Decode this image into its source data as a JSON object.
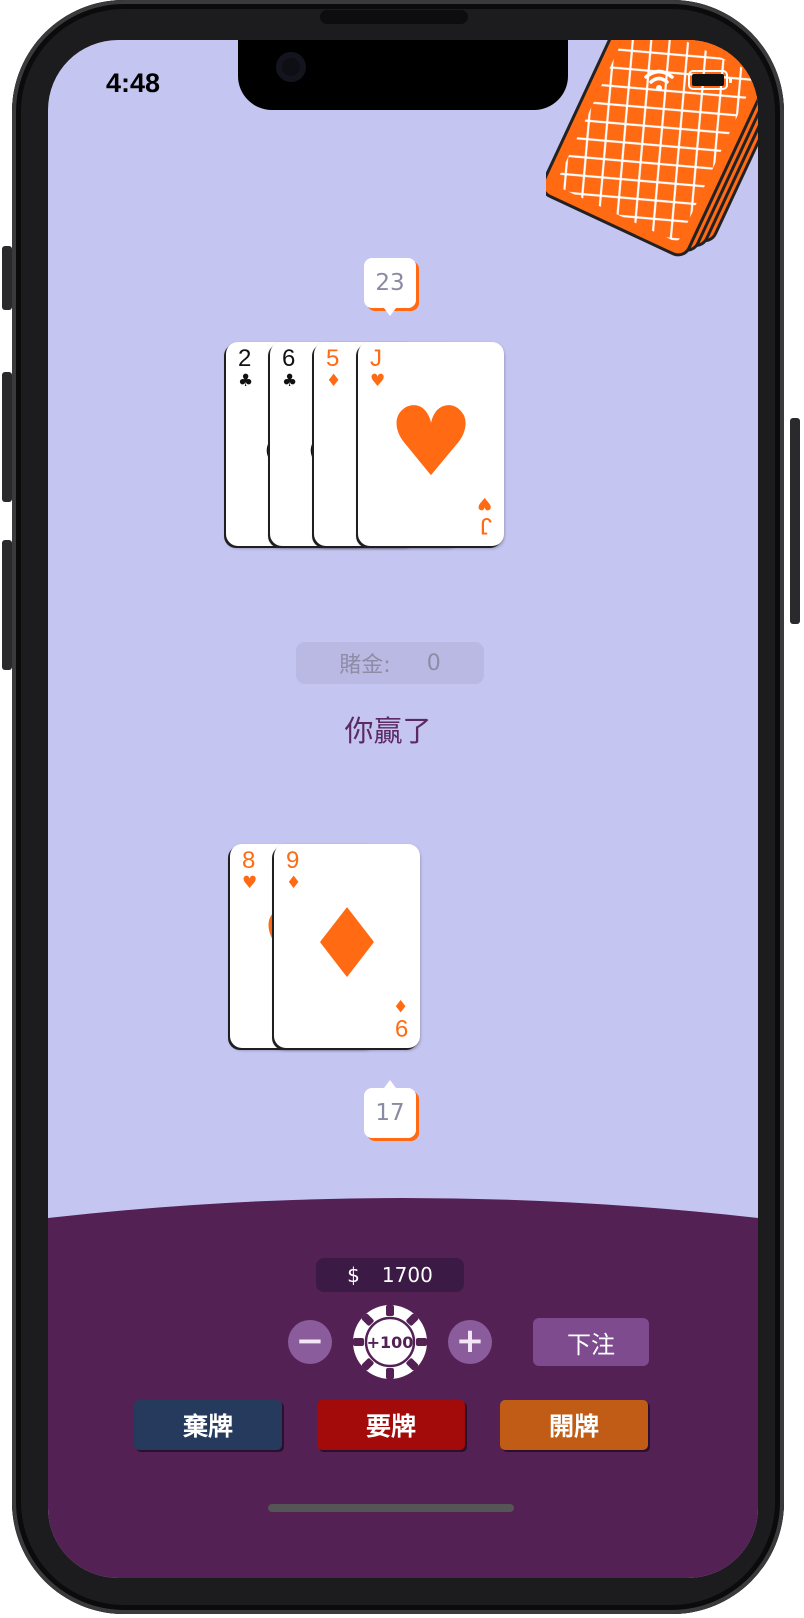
{
  "status_bar": {
    "time": "4:48"
  },
  "dealer": {
    "score": "23",
    "cards": [
      {
        "rank": "2",
        "suit": "♣",
        "color": "black"
      },
      {
        "rank": "6",
        "suit": "♣",
        "color": "black"
      },
      {
        "rank": "5",
        "suit": "♦",
        "color": "orange"
      },
      {
        "rank": "J",
        "suit": "♥",
        "color": "orange"
      }
    ]
  },
  "bet": {
    "label": "賭金:",
    "amount": "0"
  },
  "result_message": "你贏了",
  "player": {
    "score": "17",
    "cards": [
      {
        "rank": "8",
        "suit": "♥",
        "color": "orange"
      },
      {
        "rank": "9",
        "suit": "♦",
        "color": "orange"
      }
    ]
  },
  "wallet": {
    "currency": "$",
    "balance": "1700"
  },
  "controls": {
    "decrease_label": "−",
    "chip_label": "+100",
    "increase_label": "+",
    "place_bet_label": "下注",
    "fold_label": "棄牌",
    "hit_label": "要牌",
    "stand_label": "開牌"
  },
  "colors": {
    "table_bg": "#c5c5f2",
    "panel_bg": "#532154",
    "accent_orange": "#ff6a13",
    "fold_button": "#263a5e",
    "hit_button": "#a30a0a",
    "stand_button": "#c05c15",
    "bet_button": "#7d4b8e"
  }
}
